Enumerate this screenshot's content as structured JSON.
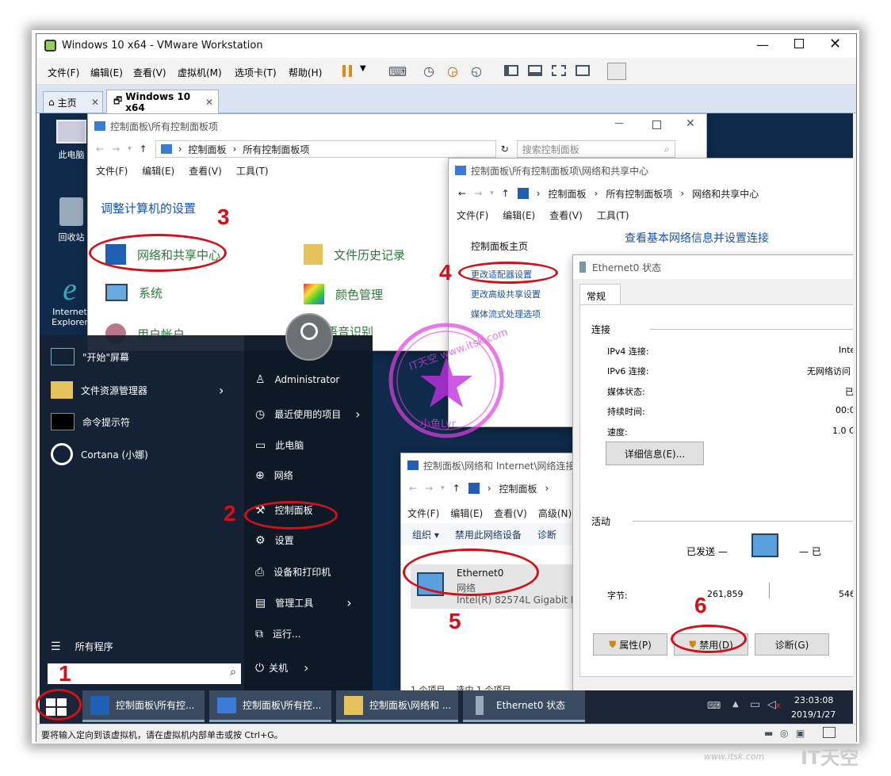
{
  "vmware": {
    "title": "Windows 10 x64 - VMware Workstation",
    "menu": [
      "文件(F)",
      "编辑(E)",
      "查看(V)",
      "虚拟机(M)",
      "选项卡(T)",
      "帮助(H)"
    ],
    "tabs": [
      {
        "label": "主页"
      },
      {
        "label": "Windows 10 x64"
      }
    ],
    "status_text": "要将输入定向到该虚拟机，请在虚拟机内部单击或按 Ctrl+G。"
  },
  "desktop_icons": [
    "此电脑",
    "回收站",
    "Internet Explorer"
  ],
  "cp_window": {
    "title": "控制面板\\所有控制面板项",
    "path": [
      "控制面板",
      "所有控制面板项"
    ],
    "search_placeholder": "搜索控制面板",
    "menu": [
      "文件(F)",
      "编辑(E)",
      "查看(V)",
      "工具(T)"
    ],
    "heading": "调整计算机的设置",
    "items": [
      "网络和共享中心",
      "文件历史记录",
      "系统",
      "颜色管理",
      "用户帐户",
      "语音识别"
    ]
  },
  "nsc_window": {
    "title": "控制面板\\所有控制面板项\\网络和共享中心",
    "path": [
      "控制面板",
      "所有控制面板项",
      "网络和共享中心"
    ],
    "menu": [
      "文件(F)",
      "编辑(E)",
      "查看(V)",
      "工具(T)"
    ],
    "heading": "查看基本网络信息并设置连接",
    "sidebar": [
      "控制面板主页",
      "更改适配器设置",
      "更改高级共享设置",
      "媒体流式处理选项"
    ]
  },
  "netconn_window": {
    "title": "控制面板\\网络和 Internet\\网络连接",
    "path": [
      "控制面板"
    ],
    "menu": [
      "文件(F)",
      "编辑(E)",
      "查看(V)",
      "高级(N)"
    ],
    "toolbar": [
      "组织 ▾",
      "禁用此网络设备",
      "诊断"
    ],
    "adapter": {
      "name": "Ethernet0",
      "type": "网络",
      "device": "Intel(R) 82574L Gigabit Ne"
    },
    "footer": "1 个项目    选中 1 个项目"
  },
  "status_window": {
    "title": "Ethernet0 状态",
    "tab": "常规",
    "connection_label": "连接",
    "rows": [
      {
        "label": "IPv4 连接:",
        "value": "Inte"
      },
      {
        "label": "IPv6 连接:",
        "value": "无网络访问"
      },
      {
        "label": "媒体状态:",
        "value": "已"
      },
      {
        "label": "持续时间:",
        "value": "00:0"
      },
      {
        "label": "速度:",
        "value": "1.0 G"
      }
    ],
    "details_button": "详细信息(E)...",
    "activity_label": "活动",
    "sent_label": "已发送 —",
    "recv_label": "— 已",
    "bytes_label": "字节:",
    "bytes_sent": "261,859",
    "bytes_recv": "546",
    "buttons": [
      "属性(P)",
      "禁用(D)",
      "诊断(G)"
    ]
  },
  "start_menu": {
    "start_screen": "\"开始\"屏幕",
    "left_items": [
      "文件资源管理器",
      "命令提示符",
      "Cortana (小娜)"
    ],
    "all_programs": "所有程序",
    "right_items": [
      "Administrator",
      "最近使用的项目",
      "此电脑",
      "网络",
      "控制面板",
      "设置",
      "设备和打印机",
      "管理工具",
      "运行...",
      "关机"
    ]
  },
  "taskbar": {
    "items": [
      "控制面板\\所有控...",
      "控制面板\\所有控...",
      "控制面板\\网络和 ...",
      "Ethernet0 状态"
    ],
    "time": "23:03:08",
    "date": "2019/1/27"
  },
  "annotations": [
    "1",
    "2",
    "3",
    "4",
    "5",
    "6"
  ],
  "watermark": {
    "ring_text": "IT天空 www.itsk.com",
    "author": "小鱼Lyr",
    "site": "www.itsk.com",
    "brand": "IT天空"
  },
  "colors": {
    "annotation_red": "#d0111b",
    "link_blue": "#1a53a8",
    "cp_green": "#2a7a3a",
    "taskbar": "#1b2535"
  }
}
